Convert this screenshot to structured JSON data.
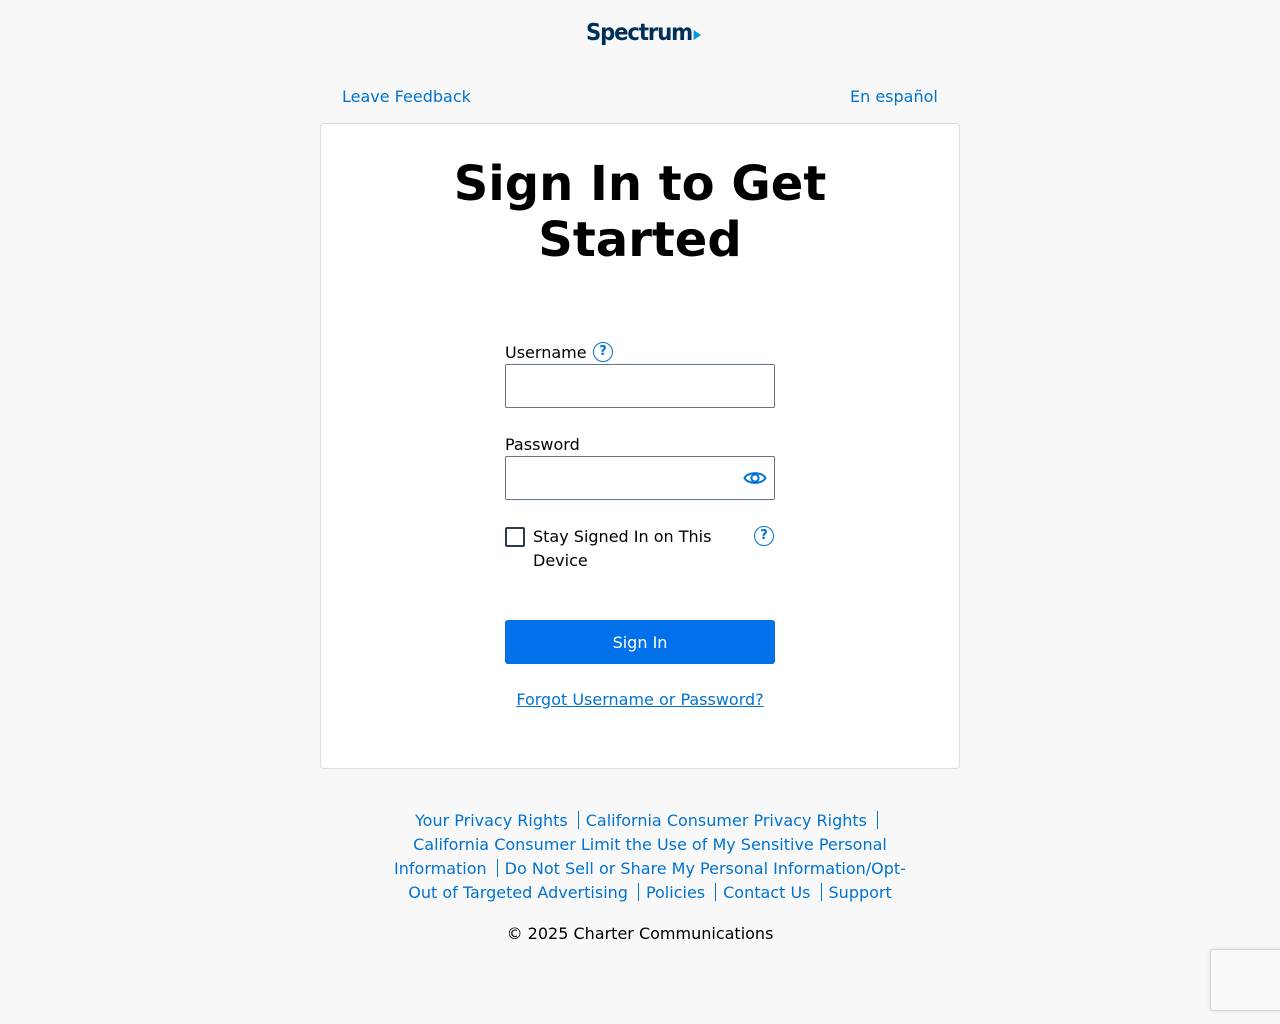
{
  "brand": {
    "logo_text": "Spectrum"
  },
  "top_links": {
    "feedback": "Leave Feedback",
    "language": "En español"
  },
  "card": {
    "title": "Sign In to Get Started",
    "username_label": "Username",
    "username_value": "",
    "password_label": "Password",
    "password_value": "",
    "stay_signed_in_label": "Stay Signed In on This Device",
    "sign_in_button": "Sign In",
    "forgot_link": "Forgot Username or Password?"
  },
  "footer": {
    "links": [
      "Your Privacy Rights",
      "California Consumer Privacy Rights",
      "California Consumer Limit the Use of My Sensitive Personal Information",
      "Do Not Sell or Share My Personal Information/Opt-Out of Targeted Advertising",
      "Policies",
      "Contact Us",
      "Support"
    ],
    "copyright": "© 2025 Charter Communications"
  },
  "colors": {
    "link": "#0073d1",
    "button": "#0071eb",
    "logo": "#003057",
    "logo_arrow": "#0099d8"
  },
  "icons": {
    "help": "question-circle-icon",
    "eye": "eye-icon",
    "logo_arrow": "play-triangle-icon"
  }
}
